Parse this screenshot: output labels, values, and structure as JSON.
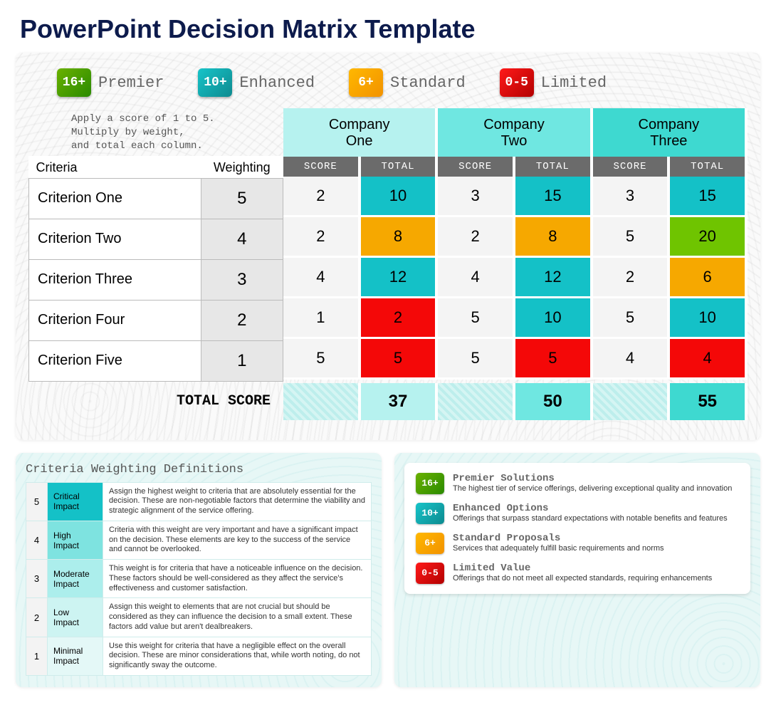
{
  "title": "PowerPoint Decision Matrix Template",
  "legend": [
    {
      "badge": "16+",
      "label": "Premier",
      "cls": "badge-green"
    },
    {
      "badge": "10+",
      "label": "Enhanced",
      "cls": "badge-teal"
    },
    {
      "badge": "6+",
      "label": "Standard",
      "cls": "badge-orange"
    },
    {
      "badge": "0-5",
      "label": "Limited",
      "cls": "badge-red"
    }
  ],
  "instructions": "Apply a score of 1 to 5.\nMultiply by weight,\nand total each column.",
  "headers": {
    "criteria": "Criteria",
    "weighting": "Weighting",
    "score": "SCORE",
    "total": "TOTAL",
    "total_score": "TOTAL SCORE"
  },
  "companies": [
    "Company\nOne",
    "Company\nTwo",
    "Company\nThree"
  ],
  "criteria": [
    {
      "name": "Criterion One",
      "weight": 5
    },
    {
      "name": "Criterion Two",
      "weight": 4
    },
    {
      "name": "Criterion Three",
      "weight": 3
    },
    {
      "name": "Criterion Four",
      "weight": 2
    },
    {
      "name": "Criterion Five",
      "weight": 1
    }
  ],
  "scores": {
    "c1": [
      2,
      2,
      4,
      1,
      5
    ],
    "c2": [
      3,
      2,
      4,
      5,
      5
    ],
    "c3": [
      3,
      5,
      2,
      5,
      4
    ]
  },
  "totals": {
    "c1": [
      10,
      8,
      12,
      2,
      5
    ],
    "c2": [
      15,
      8,
      12,
      10,
      5
    ],
    "c3": [
      15,
      20,
      6,
      10,
      4
    ]
  },
  "total_colors": {
    "c1": [
      "c-teal",
      "c-orange",
      "c-teal",
      "c-red",
      "c-red"
    ],
    "c2": [
      "c-teal",
      "c-orange",
      "c-teal",
      "c-teal",
      "c-red"
    ],
    "c3": [
      "c-teal",
      "c-green",
      "c-orange",
      "c-teal",
      "c-red"
    ]
  },
  "grand_totals": {
    "c1": 37,
    "c2": 50,
    "c3": 55
  },
  "definitions_title": "Criteria Weighting Definitions",
  "definitions": [
    {
      "n": 5,
      "impact": "Critical Impact",
      "cls": "imp-5",
      "desc": "Assign the highest weight to criteria that are absolutely essential for the decision. These are non-negotiable factors that determine the viability and strategic alignment of the service offering."
    },
    {
      "n": 4,
      "impact": "High Impact",
      "cls": "imp-4",
      "desc": "Criteria with this weight are very important and have a significant impact on the decision. These elements are key to the success of the service and cannot be overlooked."
    },
    {
      "n": 3,
      "impact": "Moderate Impact",
      "cls": "imp-3",
      "desc": "This weight is for criteria that have a noticeable influence on the decision. These factors should be well-considered as they affect the service's effectiveness and customer satisfaction."
    },
    {
      "n": 2,
      "impact": "Low Impact",
      "cls": "imp-2",
      "desc": "Assign this weight to elements that are not crucial but should be considered as they can influence the decision to a small extent. These factors add value but aren't dealbreakers."
    },
    {
      "n": 1,
      "impact": "Minimal Impact",
      "cls": "imp-1",
      "desc": "Use this weight for criteria that have a negligible effect on the overall decision. These are minor considerations that, while worth noting, do not significantly sway the outcome."
    }
  ],
  "tiers": [
    {
      "badge": "16+",
      "cls": "badge-green",
      "name": "Premier Solutions",
      "desc": "The highest tier of service offerings, delivering exceptional quality and innovation"
    },
    {
      "badge": "10+",
      "cls": "badge-teal",
      "name": "Enhanced Options",
      "desc": "Offerings that surpass standard expectations with notable benefits and features"
    },
    {
      "badge": "6+",
      "cls": "badge-orange",
      "name": "Standard Proposals",
      "desc": "Services that adequately fulfill basic requirements and norms"
    },
    {
      "badge": "0-5",
      "cls": "badge-red",
      "name": "Limited Value",
      "desc": "Offerings that do not meet all expected standards, requiring enhancements"
    }
  ]
}
